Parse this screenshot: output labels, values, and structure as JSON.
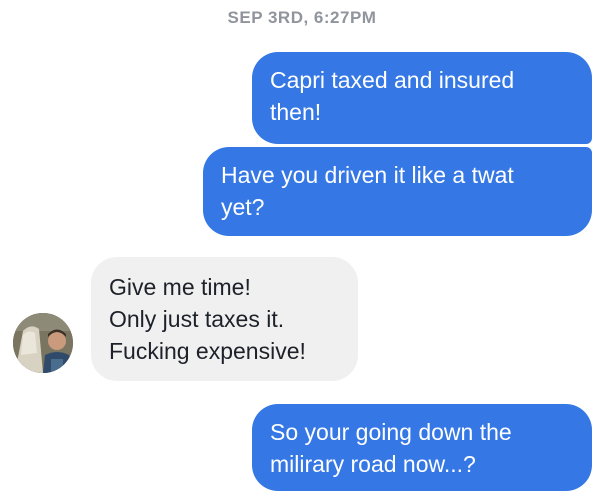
{
  "conversation": {
    "timestamp": "SEP 3RD, 6:27PM",
    "messages": [
      {
        "direction": "outgoing",
        "lines": [
          "Capri taxed and insured",
          "then!"
        ]
      },
      {
        "direction": "outgoing",
        "lines": [
          "Have you driven it like a twat",
          "yet?"
        ]
      },
      {
        "direction": "incoming",
        "lines": [
          "Give me time!",
          "Only just taxes it.",
          "Fucking expensive!"
        ],
        "avatar_icon": "user-photo-avatar"
      },
      {
        "direction": "outgoing",
        "lines": [
          "So your going down the",
          "milirary road now...?"
        ]
      }
    ]
  },
  "colors": {
    "outgoing_bubble": "#3578e5",
    "incoming_bubble": "#f1f0f0",
    "timestamp_text": "#90949c"
  }
}
